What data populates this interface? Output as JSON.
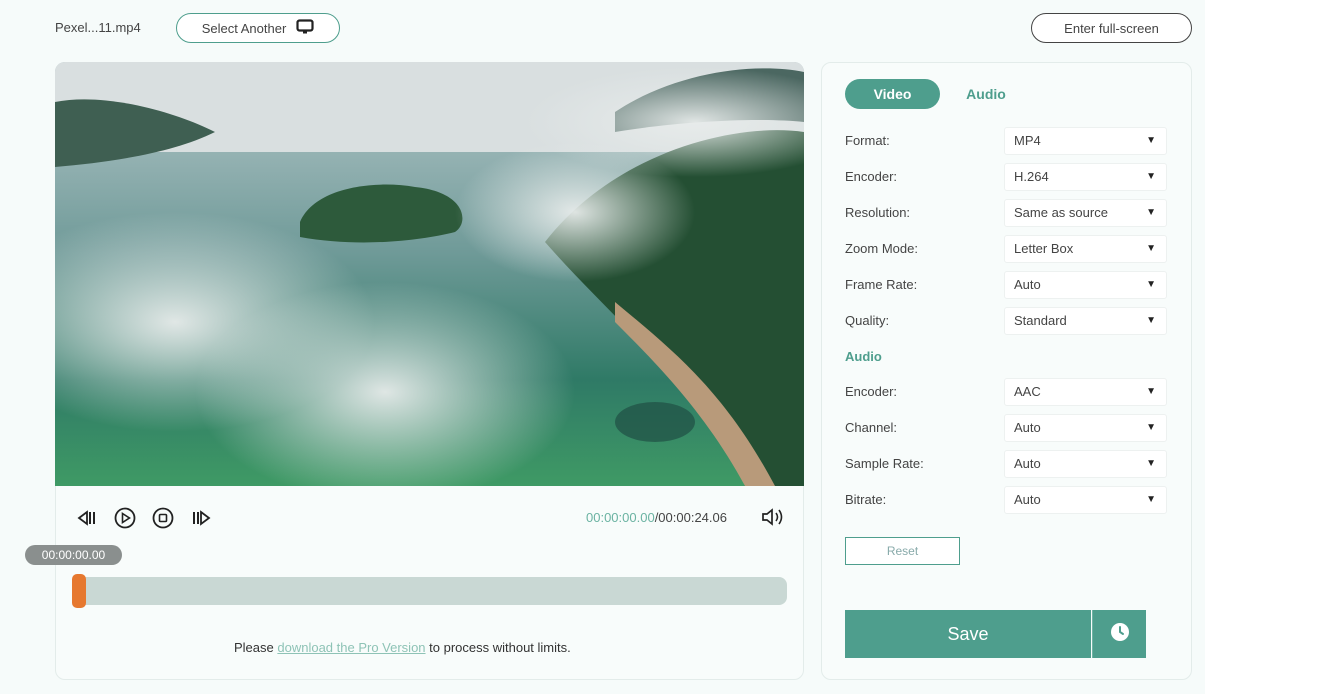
{
  "header": {
    "filename": "Pexel...11.mp4",
    "select_another": "Select Another",
    "fullscreen": "Enter full-screen"
  },
  "player": {
    "time_current": "00:00:00.00",
    "time_total": "/00:00:24.06",
    "tooltip_time": "00:00:00.00",
    "progress": 0
  },
  "promo": {
    "before": "Please ",
    "link": "download the Pro Version",
    "after": " to process without limits."
  },
  "tabs": {
    "video": "Video",
    "audio": "Audio"
  },
  "video_settings": [
    {
      "label": "Format:",
      "value": "MP4"
    },
    {
      "label": "Encoder:",
      "value": "H.264"
    },
    {
      "label": "Resolution:",
      "value": "Same as source"
    },
    {
      "label": "Zoom Mode:",
      "value": "Letter Box"
    },
    {
      "label": "Frame Rate:",
      "value": "Auto"
    },
    {
      "label": "Quality:",
      "value": "Standard"
    }
  ],
  "audio_section_title": "Audio",
  "audio_settings": [
    {
      "label": "Encoder:",
      "value": "AAC"
    },
    {
      "label": "Channel:",
      "value": "Auto"
    },
    {
      "label": "Sample Rate:",
      "value": "Auto"
    },
    {
      "label": "Bitrate:",
      "value": "Auto"
    }
  ],
  "reset": "Reset",
  "save": "Save",
  "colors": {
    "accent": "#4e9e8d",
    "playhead": "#e6782f",
    "link": "#8ec3b6"
  },
  "icons": [
    "monitor-icon",
    "step-back-icon",
    "play-icon",
    "stop-icon",
    "step-forward-icon",
    "volume-icon",
    "clock-icon",
    "caret-down-icon"
  ]
}
